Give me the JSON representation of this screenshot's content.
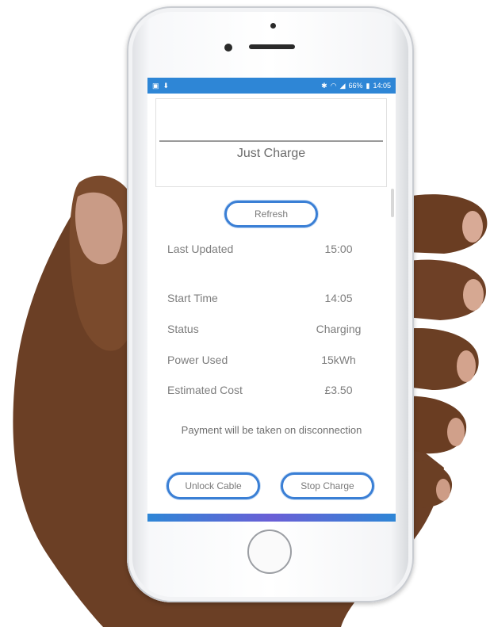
{
  "status_bar": {
    "time": "14:05",
    "battery": "66%"
  },
  "header": {
    "title": "Just Charge"
  },
  "actions": {
    "refresh": "Refresh",
    "unlock_cable": "Unlock Cable",
    "stop_charge": "Stop Charge"
  },
  "details": [
    {
      "label": "Last Updated",
      "value": "15:00"
    },
    {
      "label": "Start Time",
      "value": "14:05"
    },
    {
      "label": "Status",
      "value": "Charging"
    },
    {
      "label": "Power Used",
      "value": "15kWh"
    },
    {
      "label": "Estimated Cost",
      "value": "£3.50"
    }
  ],
  "note": "Payment will be taken on disconnection",
  "colors": {
    "accent": "#2e86d6",
    "button_border": "#3a7fd5"
  }
}
